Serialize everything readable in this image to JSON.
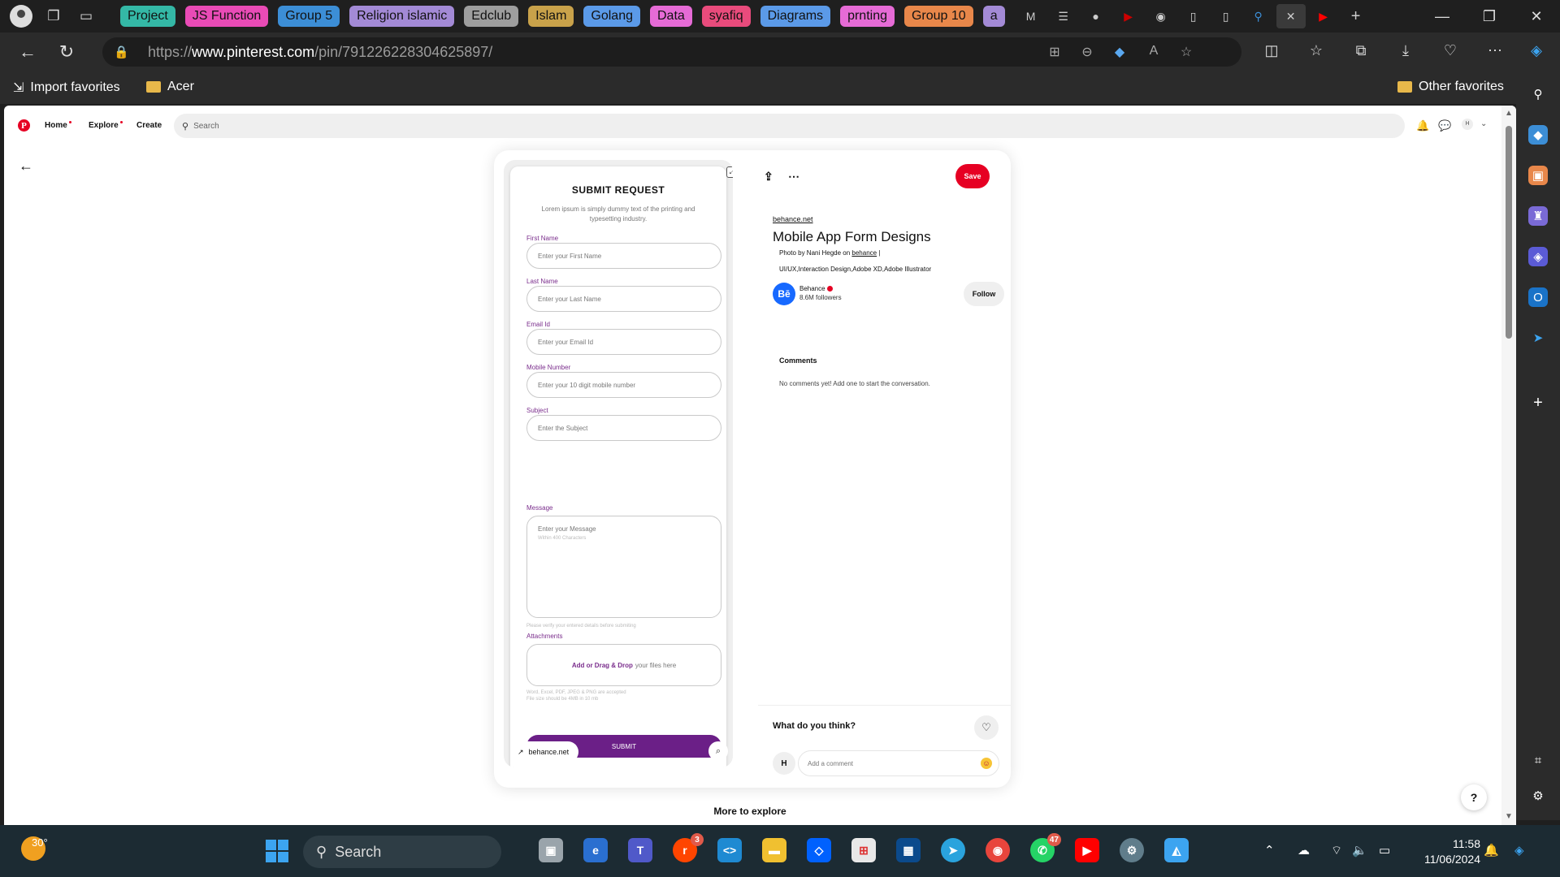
{
  "browser": {
    "tab_groups": [
      {
        "label": "Project",
        "color": "#34b8a6"
      },
      {
        "label": "JS Function",
        "color": "#e94bb6"
      },
      {
        "label": "Group 5",
        "color": "#3c8ed6"
      },
      {
        "label": "Religion islamic",
        "color": "#a38ad6"
      },
      {
        "label": "Edclub",
        "color": "#9e9e9e"
      },
      {
        "label": "Islam",
        "color": "#c9a24a"
      },
      {
        "label": "Golang",
        "color": "#5b9ae8"
      },
      {
        "label": "Data",
        "color": "#e66bd6"
      },
      {
        "label": "syafiq",
        "color": "#e94b7c"
      },
      {
        "label": "Diagrams",
        "color": "#5b9ae8"
      },
      {
        "label": "prnting",
        "color": "#e66bd6"
      },
      {
        "label": "Group 10",
        "color": "#e8874a"
      },
      {
        "label": "a",
        "color": "#a38ad6"
      }
    ],
    "url_host": "www.pinterest.com",
    "url_path": "/pin/791226228304625897/",
    "url_scheme": "https://",
    "favorites": {
      "import_label": "Import favorites",
      "folder_acer": "Acer",
      "other_favorites": "Other favorites"
    }
  },
  "pinterest": {
    "nav": {
      "home": "Home",
      "explore": "Explore",
      "create": "Create",
      "search_placeholder": "Search",
      "avatar_initial": "H"
    },
    "form": {
      "title": "SUBMIT REQUEST",
      "subtitle": "Lorem ipsum is simply dummy text of the printing and typesetting industry.",
      "fields": [
        {
          "label": "First Name",
          "placeholder": "Enter your First Name"
        },
        {
          "label": "Last Name",
          "placeholder": "Enter your Last Name"
        },
        {
          "label": "Email Id",
          "placeholder": "Enter your Email Id"
        },
        {
          "label": "Mobile Number",
          "placeholder": "Enter your 10 digit mobile number"
        },
        {
          "label": "Subject",
          "placeholder": "Enter the Subject"
        }
      ],
      "message_label": "Message",
      "message_placeholder": "Enter your Message",
      "message_hint": "Within 400 Characters",
      "verify_hint": "Please verify your entered details before submiting",
      "attachments_label": "Attachments",
      "drop_bold": "Add or Drag & Drop",
      "drop_rest": "your files here",
      "file_hint_1": "Word, Excel, PDF, JPEG & PNG are accepted",
      "file_hint_2": "File size should be 4MB in 10 mb",
      "submit_label": "SUBMIT"
    },
    "source_chip": "behance.net",
    "pin": {
      "domain": "behance.net",
      "title": "Mobile App Form Designs",
      "photo_by_prefix": "Photo by Nani Hegde on",
      "photo_by_link": "behance",
      "photo_by_suffix": "|",
      "tags": "UI/UX,Interaction Design,Adobe XD,Adobe Illustrator",
      "save_label": "Save",
      "creator_name": "Behance",
      "creator_followers": "8.6M followers",
      "creator_avatar_text": "Bē",
      "follow_label": "Follow",
      "comments_heading": "Comments",
      "no_comments": "No comments yet! Add one to start the conversation.",
      "what_think": "What do you think?",
      "user_initial": "H",
      "comment_placeholder": "Add a comment"
    },
    "more_to_explore": "More to explore",
    "help_label": "?"
  },
  "taskbar": {
    "temperature": "30°",
    "search_label": "Search",
    "reddit_badge": "3",
    "whatsapp_badge": "47",
    "time": "11:58",
    "date": "11/06/2024"
  }
}
